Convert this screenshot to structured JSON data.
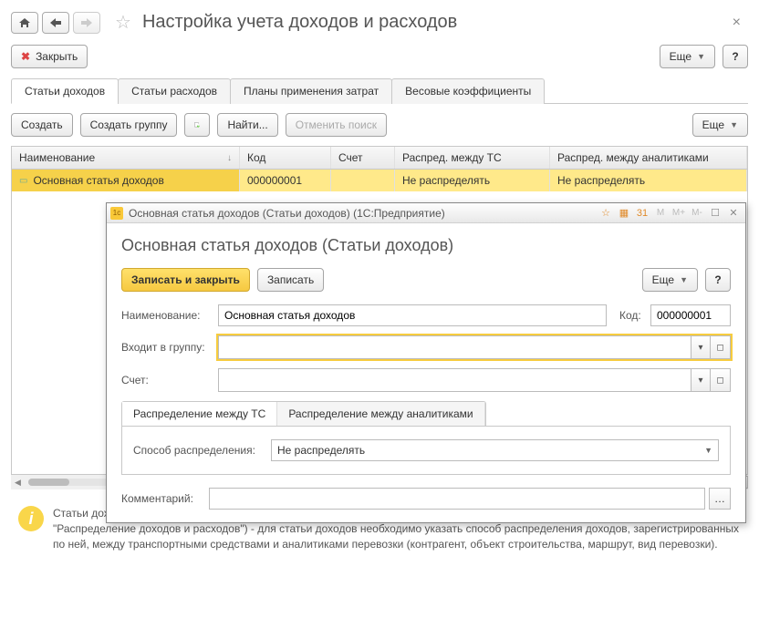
{
  "header": {
    "title": "Настройка учета доходов и расходов",
    "close_label": "Закрыть",
    "more_label": "Еще"
  },
  "tabs": [
    {
      "label": "Статьи доходов",
      "active": true
    },
    {
      "label": "Статьи расходов"
    },
    {
      "label": "Планы применения затрат"
    },
    {
      "label": "Весовые коэффициенты"
    }
  ],
  "grid_toolbar": {
    "create": "Создать",
    "create_group": "Создать группу",
    "find": "Найти...",
    "cancel_find": "Отменить поиск",
    "more": "Еще"
  },
  "grid": {
    "columns": {
      "name": "Наименование",
      "code": "Код",
      "acct": "Счет",
      "dist_ts": "Распред. между ТС",
      "dist_an": "Распред. между аналитиками"
    },
    "rows": [
      {
        "name": "Основная статья доходов",
        "code": "000000001",
        "acct": "",
        "dist_ts": "Не распределять",
        "dist_an": "Не распределять"
      }
    ]
  },
  "info": "Статьи доходов служат для классификации доходов предприятия. Если предприятие формирует финансовый результат (документ \"Распределение доходов и расходов\") - для статьи доходов необходимо указать способ распределения доходов, зарегистрированных по ней, между транспортными средствами и аналитиками перевозки (контрагент, объект строительства, маршрут, вид перевозки).",
  "dialog": {
    "window_title": "Основная статья доходов (Статьи доходов)  (1С:Предприятие)",
    "title": "Основная статья доходов (Статьи доходов)",
    "save_close": "Записать и закрыть",
    "save": "Записать",
    "more": "Еще",
    "labels": {
      "name": "Наименование:",
      "code": "Код:",
      "group": "Входит в группу:",
      "acct": "Счет:",
      "method": "Способ распределения:",
      "comment": "Комментарий:"
    },
    "values": {
      "name": "Основная статья доходов",
      "code": "000000001",
      "group": "",
      "acct": "",
      "method": "Не распределять",
      "comment": ""
    },
    "inner_tabs": [
      {
        "label": "Распределение между ТС",
        "active": true
      },
      {
        "label": "Распределение между аналитиками"
      }
    ]
  }
}
